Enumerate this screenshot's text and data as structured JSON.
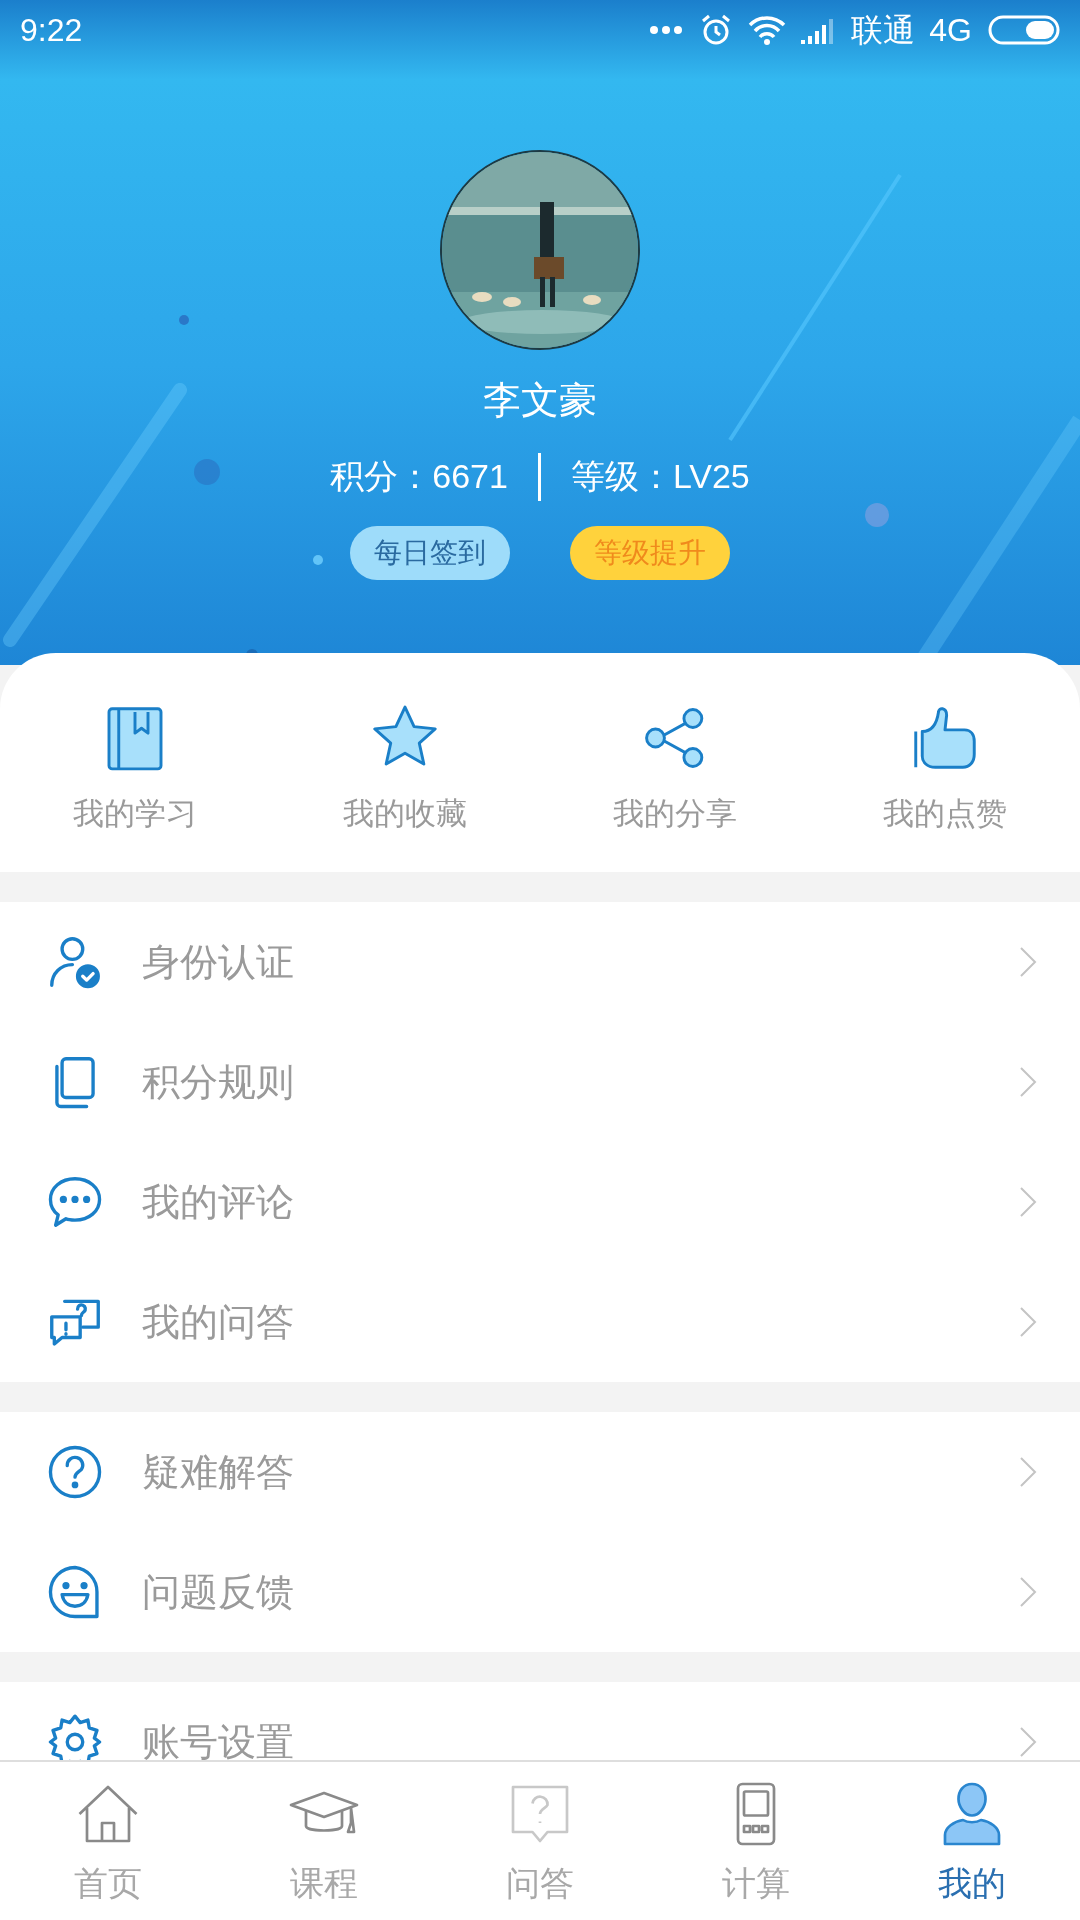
{
  "status_bar": {
    "time": "9:22",
    "carrier": "联通",
    "network": "4G"
  },
  "profile": {
    "name": "李文豪",
    "points": "积分：6671",
    "level_text": "等级：LV25",
    "buttons": [
      "每日签到",
      "等级提升"
    ]
  },
  "shortcuts": [
    "我的学习",
    "我的收藏",
    "我的分享",
    "我的点赞"
  ],
  "menu_groups": [
    [
      "身份认证",
      "积分规则",
      "我的评论",
      "我的问答"
    ],
    [
      "疑难解答",
      "问题反馈"
    ],
    [
      "账号设置"
    ]
  ],
  "tab_bar": [
    {
      "label": "首页",
      "selected": false
    },
    {
      "label": "课程",
      "selected": false
    },
    {
      "label": "问答",
      "selected": false
    },
    {
      "label": "计算",
      "selected": false
    },
    {
      "label": "我的",
      "selected": true
    }
  ]
}
